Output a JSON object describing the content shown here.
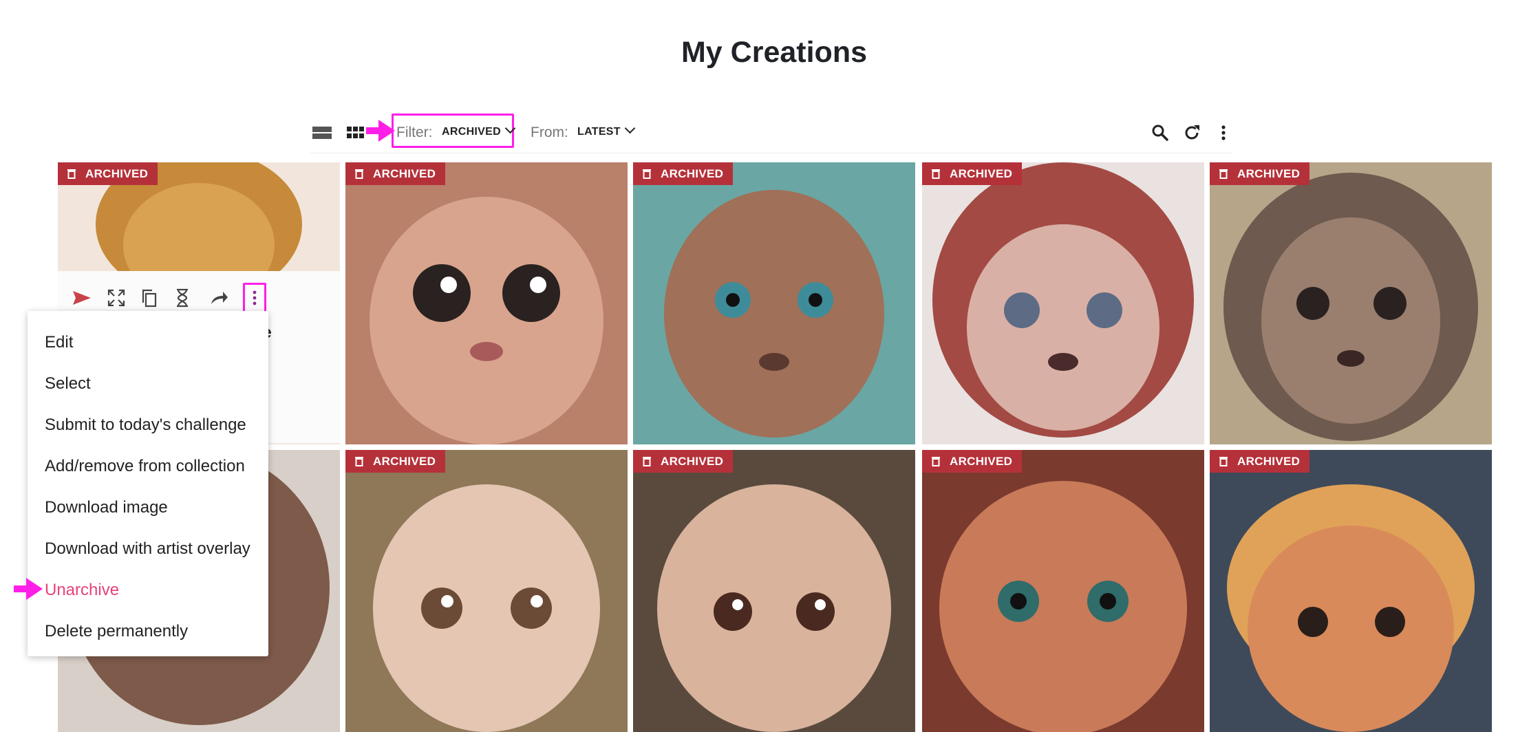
{
  "page": {
    "title": "My Creations"
  },
  "toolbar": {
    "filter_label": "Filter:",
    "filter_value": "ARCHIVED",
    "from_label": "From:",
    "from_value": "LATEST",
    "icons": [
      "list-view-icon",
      "grid-view-icon",
      "search-icon",
      "refresh-icon",
      "more-vertical-icon"
    ]
  },
  "grid": {
    "badge_label": "ARCHIVED",
    "badge_color": "#b5313a",
    "tile_count_visible": 10
  },
  "card": {
    "partial_title": "ble",
    "actions": [
      "send-icon",
      "expand-icon",
      "copy-icon",
      "hourglass-icon",
      "share-icon",
      "more-vertical-icon"
    ]
  },
  "menu": {
    "items": [
      "Edit",
      "Select",
      "Submit to today's challenge",
      "Add/remove from collection",
      "Download image",
      "Download with artist overlay",
      "Unarchive",
      "Delete permanently"
    ],
    "highlight_color": "#e8417a",
    "annotation_color": "#ff1ee8"
  }
}
